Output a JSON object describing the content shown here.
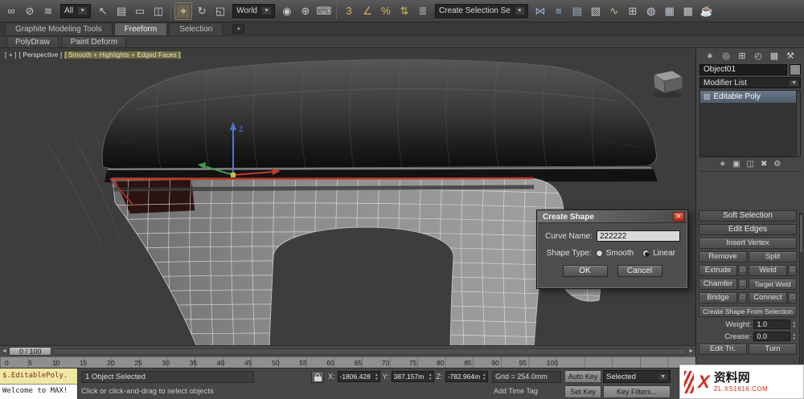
{
  "icons": {
    "dropdown_arrow": "▼",
    "spinner_up": "▴",
    "spinner_down": "▾",
    "arrow_left": "◄",
    "arrow_right": "►",
    "settings_box": "□",
    "close_glyph": "✕",
    "ribbon_toggle": "▾"
  },
  "toolbar": {
    "filter_dropdown": "All",
    "coord_dropdown": "World",
    "selection_set_dropdown": "Create Selection Se",
    "icon_groups": {
      "link": [
        {
          "name": "select-and-link-icon",
          "glyph": "∞"
        },
        {
          "name": "unlink-selection-icon",
          "glyph": "⊘"
        },
        {
          "name": "bind-to-spacewarp-icon",
          "glyph": "≋"
        }
      ],
      "select": [
        {
          "name": "select-object-icon",
          "glyph": "↖"
        },
        {
          "name": "select-by-name-icon",
          "glyph": "▤"
        },
        {
          "name": "selection-region-icon",
          "glyph": "▭"
        },
        {
          "name": "window-crossing-icon",
          "glyph": "◫"
        }
      ],
      "transform": [
        {
          "name": "select-and-move-icon",
          "glyph": "⌖",
          "active": true
        },
        {
          "name": "select-and-rotate-icon",
          "glyph": "↻"
        },
        {
          "name": "select-and-scale-icon",
          "glyph": "◱"
        }
      ],
      "pivot": [
        {
          "name": "use-pivot-center-icon",
          "glyph": "◉"
        },
        {
          "name": "select-and-manipulate-icon",
          "glyph": "⊕"
        },
        {
          "name": "keyboard-override-icon",
          "glyph": "⌨"
        }
      ],
      "snaps": [
        {
          "name": "snaps-toggle-3d-icon",
          "glyph": "3",
          "color": "#d8b25a"
        },
        {
          "name": "angle-snap-icon",
          "glyph": "∠",
          "color": "#d8b25a"
        },
        {
          "name": "percent-snap-icon",
          "glyph": "%",
          "color": "#d8b25a"
        },
        {
          "name": "spinner-snap-icon",
          "glyph": "⇅",
          "color": "#d8b25a"
        }
      ],
      "sets": [
        {
          "name": "edit-named-selections-icon",
          "glyph": "≣"
        }
      ],
      "tools": [
        {
          "name": "mirror-icon",
          "glyph": "⋈",
          "color": "#8fb4d8"
        },
        {
          "name": "align-icon",
          "glyph": "≡",
          "color": "#8fb4d8"
        },
        {
          "name": "layer-manager-icon",
          "glyph": "▤",
          "color": "#9ab8d0"
        },
        {
          "name": "graphite-ribbon-icon",
          "glyph": "▧"
        },
        {
          "name": "curve-editor-icon",
          "glyph": "∿",
          "color": "#a8c89a"
        },
        {
          "name": "schematic-view-icon",
          "glyph": "⊞"
        },
        {
          "name": "material-editor-icon",
          "glyph": "◍",
          "color": "#c8d0e0"
        },
        {
          "name": "render-setup-icon",
          "glyph": "▦",
          "color": "#c0c8d8"
        },
        {
          "name": "rendered-frame-icon",
          "glyph": "▩"
        },
        {
          "name": "render-production-icon",
          "glyph": "☕",
          "color": "#c8d8e8"
        }
      ]
    }
  },
  "ribbon": {
    "tab_graphite": "Graphite Modeling Tools",
    "tab_freeform": "Freeform",
    "tab_selection": "Selection",
    "subtab_polydraw": "PolyDraw",
    "subtab_paintdeform": "Paint Deform"
  },
  "viewport": {
    "seg1": "[ + ]",
    "seg2": "[ Perspective ]",
    "seg3": "[ Smooth + Highlights + Edged Faces ]",
    "gizmo_z_label": "Z"
  },
  "dialog": {
    "title": "Create Shape",
    "curve_name_label": "Curve Name:",
    "curve_name_value": "222222",
    "shape_type_label": "Shape Type:",
    "radio_smooth": "Smooth",
    "radio_linear": "Linear",
    "ok": "OK",
    "cancel": "Cancel"
  },
  "command_panel": {
    "object_name": "Object01",
    "modifier_list_label": "Modifier List",
    "stack_item": "Editable Poly",
    "panel_tabs": [
      {
        "name": "create-tab-icon",
        "glyph": "∗"
      },
      {
        "name": "modify-tab-icon",
        "glyph": "◎"
      },
      {
        "name": "hierarchy-tab-icon",
        "glyph": "⊞"
      },
      {
        "name": "motion-tab-icon",
        "glyph": "◴"
      },
      {
        "name": "display-tab-icon",
        "glyph": "▦"
      },
      {
        "name": "utilities-tab-icon",
        "glyph": "⚒"
      }
    ],
    "stack_tools": [
      {
        "name": "pin-stack-icon",
        "glyph": "∗"
      },
      {
        "name": "show-end-result-icon",
        "glyph": "▣"
      },
      {
        "name": "make-unique-icon",
        "glyph": "◫"
      },
      {
        "name": "remove-modifier-icon",
        "glyph": "✖"
      },
      {
        "name": "configure-modifier-sets-icon",
        "glyph": "⚙"
      }
    ],
    "rollout_soft_selection": "Soft Selection",
    "rollout_edit_edges": "Edit Edges",
    "btn_insert_vertex": "Insert Vertex",
    "btn_remove": "Remove",
    "btn_split": "Split",
    "btn_extrude": "Extrude",
    "btn_weld": "Weld",
    "btn_chamfer": "Chamfer",
    "btn_target_weld": "Target Weld",
    "btn_bridge": "Bridge",
    "btn_connect": "Connect",
    "btn_create_shape": "Create Shape From Selection",
    "weight_label": "Weight:",
    "weight_value": "1.0",
    "crease_label": "Crease:",
    "crease_value": "0.0",
    "btn_edit_tri": "Edit Tri.",
    "btn_turn": "Turn"
  },
  "timeline": {
    "slider_label": "0 / 100",
    "ticks": [
      "0",
      "5",
      "10",
      "15",
      "20",
      "25",
      "30",
      "35",
      "40",
      "45",
      "50",
      "55",
      "60",
      "65",
      "70",
      "75",
      "80",
      "85",
      "90",
      "95",
      "100"
    ]
  },
  "status": {
    "listener_line1": "$.EditablePoly.",
    "listener_line2": "Welcome to MAX!",
    "selection_status": "1 Object Selected",
    "prompt": "Click or click-and-drag to select objects",
    "x_label": "X:",
    "x_value": "-1806.428",
    "y_label": "Y:",
    "y_value": "387.157m",
    "z_label": "Z:",
    "z_value": "-782.964m",
    "grid_status": "Grid = 254.0mm",
    "add_time_tag": "Add Time Tag",
    "auto_key": "Auto Key",
    "set_key": "Set Key",
    "selection_set": "Selected",
    "key_filters": "Key Filters..."
  },
  "watermark": {
    "glyph": "X",
    "title": "资料网",
    "domain": "ZL.XS1616.COM"
  }
}
